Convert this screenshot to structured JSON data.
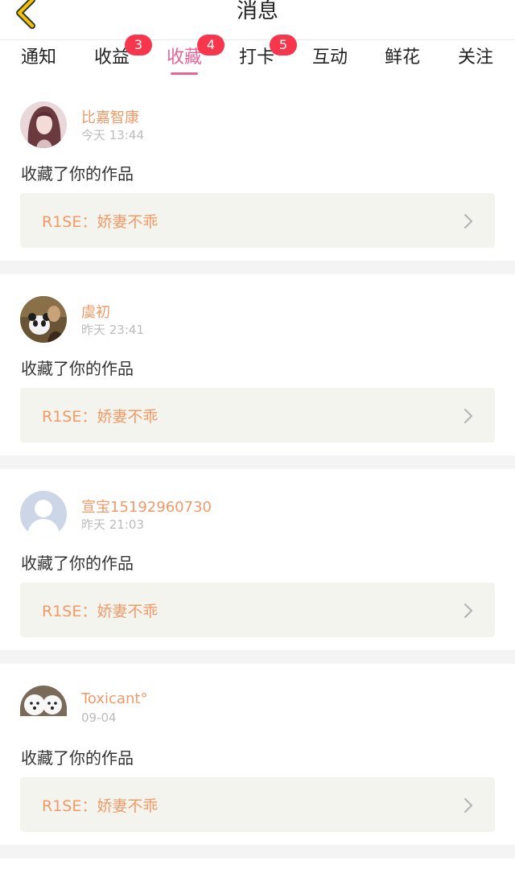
{
  "header": {
    "title": "消息"
  },
  "tabs": [
    {
      "label": "通知",
      "badge": ""
    },
    {
      "label": "收益",
      "badge": "3"
    },
    {
      "label": "收藏",
      "badge": "4"
    },
    {
      "label": "打卡",
      "badge": "5"
    },
    {
      "label": "互动",
      "badge": ""
    },
    {
      "label": "鲜花",
      "badge": ""
    },
    {
      "label": "关注",
      "badge": ""
    }
  ],
  "active_tab": "收藏",
  "colors": {
    "accent": "#e8659a",
    "badge": "#f5364d",
    "username": "#f19a68",
    "work_box": "#f4f4ee"
  },
  "messages": [
    {
      "username": "比嘉智康",
      "time": "今天 13:44",
      "action": "收藏了你的作品",
      "work_title": "R1SE：娇妻不乖",
      "avatar": "anime-girl"
    },
    {
      "username": "虞初",
      "time": "昨天 23:41",
      "action": "收藏了你的作品",
      "work_title": "R1SE：娇妻不乖",
      "avatar": "panda-photo"
    },
    {
      "username": "宣宝15192960730",
      "time": "昨天 21:03",
      "action": "收藏了你的作品",
      "work_title": "R1SE：娇妻不乖",
      "avatar": "default-user"
    },
    {
      "username": "Toxicant°",
      "time": "09-04",
      "action": "收藏了你的作品",
      "work_title": "R1SE：娇妻不乖",
      "avatar": "white-dogs"
    }
  ]
}
